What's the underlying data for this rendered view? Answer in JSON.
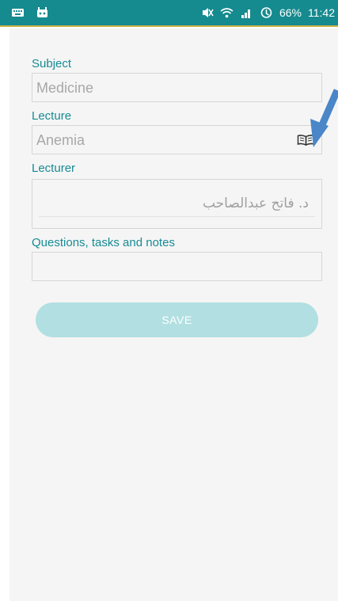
{
  "status_bar": {
    "battery": "66%",
    "time": "11:42",
    "icons": [
      "keyboard-icon",
      "android-icon",
      "mute-icon",
      "wifi-icon",
      "signal-icon",
      "data-saver-icon"
    ]
  },
  "form": {
    "subject": {
      "label": "Subject",
      "value": "Medicine"
    },
    "lecture": {
      "label": "Lecture",
      "value": "Anemia",
      "icon": "book-icon"
    },
    "lecturer": {
      "label": "Lecturer",
      "value": "د. فاتح عبدالصاحب"
    },
    "notes": {
      "label": "Questions, tasks and notes",
      "value": ""
    },
    "save_label": "SAVE"
  },
  "colors": {
    "status_bar": "#158a8f",
    "accent": "#178b94",
    "save_button": "#b2dfe2",
    "annotation_arrow": "#4a86c8"
  }
}
